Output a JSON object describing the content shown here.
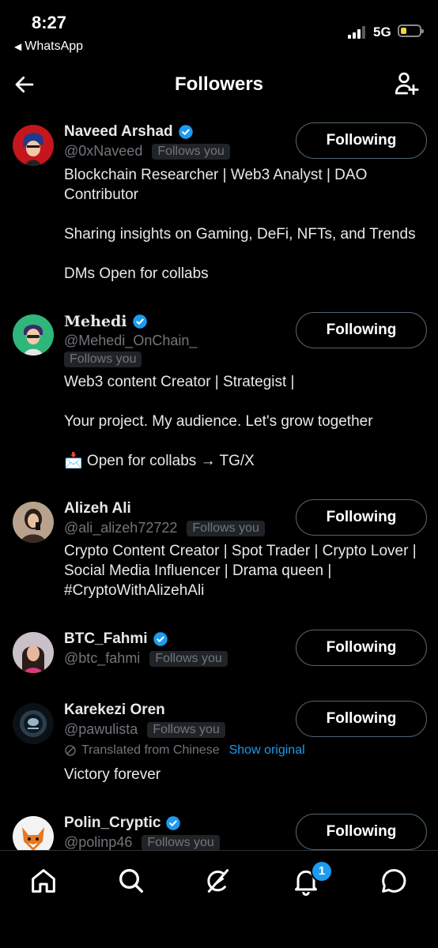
{
  "status_bar": {
    "time": "8:27",
    "back_app": "WhatsApp",
    "network": "5G"
  },
  "header": {
    "title": "Followers"
  },
  "users": [
    {
      "name": "Naveed Arshad",
      "verified": true,
      "handle": "@0xNaveed",
      "follows_you": "Follows you",
      "button": "Following",
      "bio": "Blockchain Researcher | Web3 Analyst | DAO Contributor\n\nSharing insights on Gaming, DeFi, NFTs, and Trends\n\nDMs Open for collabs"
    },
    {
      "name": "𝐌𝐞𝐡𝐞𝐝𝐢",
      "verified": true,
      "handle": "@Mehedi_OnChain_",
      "follows_you": "Follows you",
      "button": "Following",
      "bio": "Web3 content Creator | Strategist |\n\nYour project. My audience. Let's grow together\n\n📩 Open for collabs → TG/X"
    },
    {
      "name": "Alizeh Ali",
      "verified": false,
      "handle": "@ali_alizeh72722",
      "follows_you": "Follows you",
      "button": "Following",
      "bio": "Crypto Content Creator | Spot Trader | Crypto Lover | Social Media Influencer | Drama queen | #CryptoWithAlizehAli"
    },
    {
      "name": "BTC_Fahmi",
      "verified": true,
      "handle": "@btc_fahmi",
      "follows_you": "Follows you",
      "button": "Following",
      "bio": ""
    },
    {
      "name": "Karekezi Oren",
      "verified": false,
      "handle": "@pawulista",
      "follows_you": "Follows you",
      "button": "Following",
      "translated": "Translated from Chinese",
      "show_original": "Show original",
      "bio": "Victory forever"
    },
    {
      "name": "Polin_Cryptic",
      "verified": true,
      "handle": "@polinp46",
      "follows_you": "Follows you",
      "button": "Following",
      "bio": ""
    }
  ],
  "tab_bar": {
    "items": [
      "home-icon",
      "search-icon",
      "grok-icon",
      "notifications-icon",
      "messages-icon"
    ],
    "notification_badge": "1"
  },
  "colors": {
    "accent": "#1d9bf0",
    "background": "#000000",
    "secondary_text": "#71767b"
  }
}
